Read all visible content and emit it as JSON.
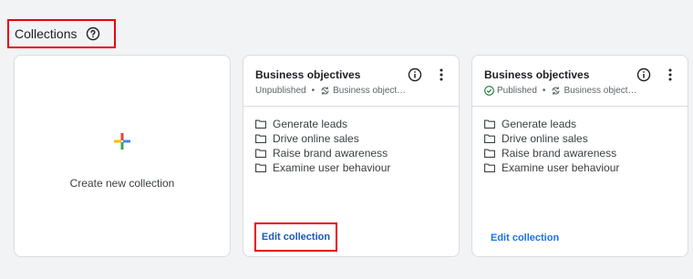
{
  "header": {
    "title": "Collections",
    "help_icon": "help-circle-icon"
  },
  "new_card": {
    "label": "Create new collection",
    "icon": "plus-icon"
  },
  "collections": [
    {
      "title": "Business objectives",
      "status": "Unpublished",
      "source": "Business object…",
      "items": [
        "Generate leads",
        "Drive online sales",
        "Raise brand awareness",
        "Examine user behaviour"
      ],
      "edit_label": "Edit collection"
    },
    {
      "title": "Business objectives",
      "status": "Published",
      "source": "Business object…",
      "items": [
        "Generate leads",
        "Drive online sales",
        "Raise brand awareness",
        "Examine user behaviour"
      ],
      "edit_label": "Edit collection"
    }
  ],
  "colors": {
    "accent": "#1a73e8",
    "highlight": "#e8000d",
    "published": "#188038"
  }
}
